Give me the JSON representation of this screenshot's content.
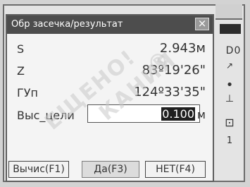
{
  "dialog": {
    "title": "Обр засечка/результат",
    "close_glyph": "×"
  },
  "rows": {
    "s": {
      "label": "S",
      "value": "2.943м"
    },
    "z": {
      "label": "Z",
      "value": "83º19'26\""
    },
    "gup": {
      "label": "ГУп",
      "value": "124º33'35\""
    },
    "target_height": {
      "label": "Выс_цели",
      "value": "0.100",
      "unit": "м"
    }
  },
  "function_keys": {
    "calc": "Вычис(F1)",
    "yes": "Да(F3)",
    "no": "НЕТ(F4)"
  },
  "side_panel": {
    "d": "D",
    "zero": "0",
    "one": "1"
  },
  "icons": {
    "battery": "battery-icon",
    "close": "close-icon",
    "target": "target-icon"
  }
}
